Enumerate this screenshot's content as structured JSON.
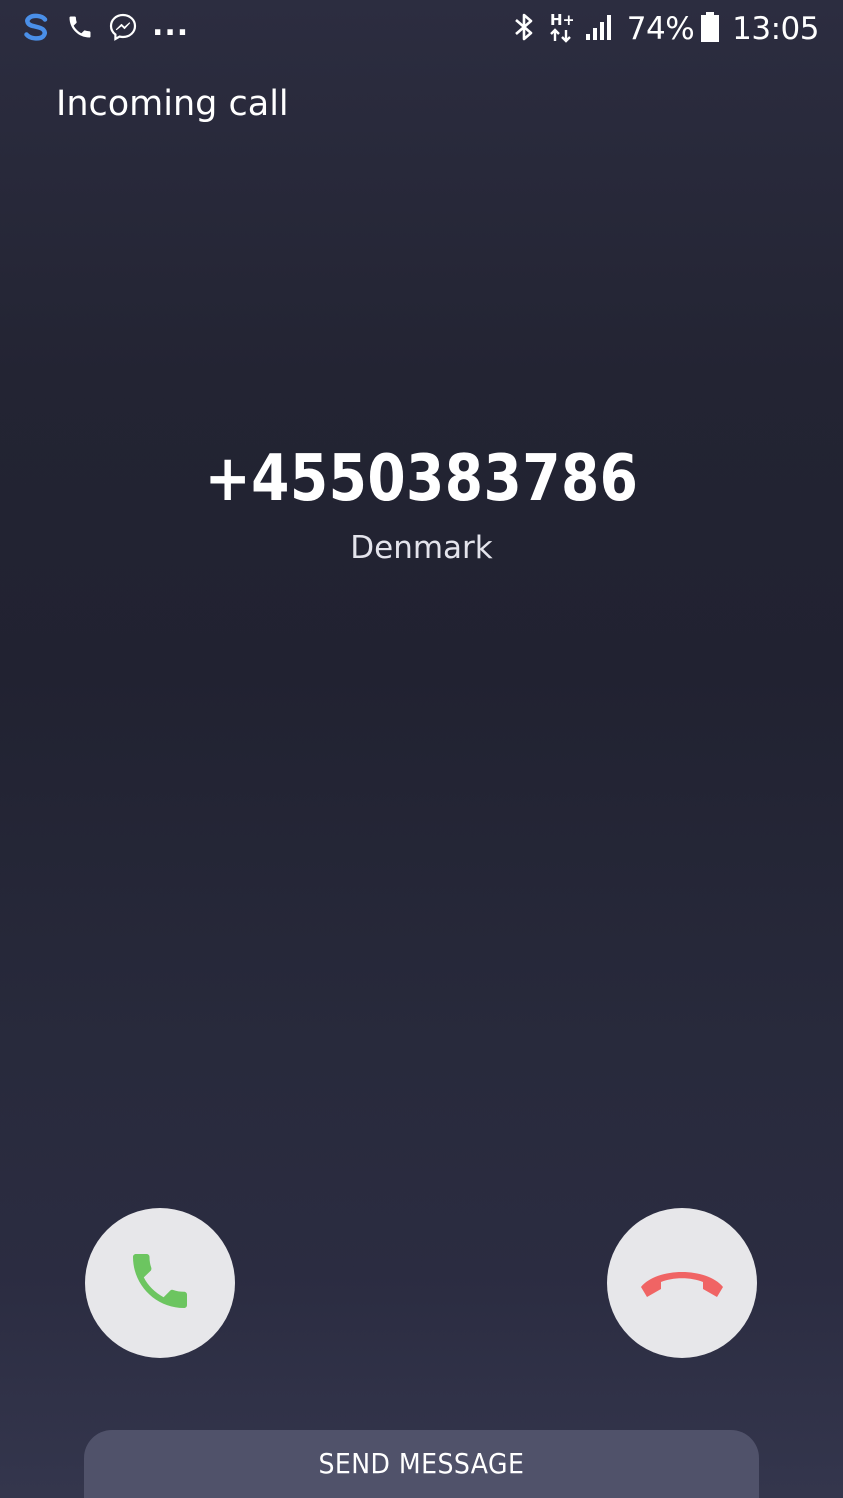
{
  "status_bar": {
    "notifications": [
      "s-app-icon",
      "phone-call-icon",
      "messenger-icon"
    ],
    "more_indicator": "...",
    "network_type": "H+",
    "battery_percent": "74%",
    "time": "13:05"
  },
  "header": {
    "title": "Incoming call"
  },
  "caller": {
    "number": "+4550383786",
    "location": "Denmark"
  },
  "actions": {
    "accept_icon": "phone-accept-icon",
    "decline_icon": "phone-decline-icon",
    "accept_color": "#6cc560",
    "decline_color": "#f06464",
    "send_message_label": "SEND MESSAGE"
  }
}
